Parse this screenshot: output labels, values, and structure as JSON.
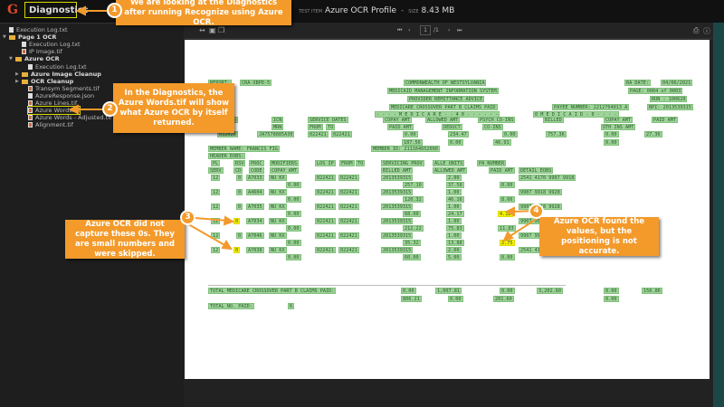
{
  "header": {
    "logo": "G",
    "title": "Diagnostics",
    "test_item_label": "TEST ITEM",
    "test_item": "Azure OCR Profile",
    "separator": "-",
    "size_label": "SIZE",
    "size": "8.43 MB"
  },
  "tree": [
    {
      "label": "Execution Log.txt",
      "icon": "file-icon"
    },
    {
      "label": "Page 1 OCR",
      "icon": "folder-icon"
    },
    {
      "label": "Execution Log.txt",
      "icon": "file-icon"
    },
    {
      "label": "IP Image.tif",
      "icon": "image-icon"
    },
    {
      "label": "Azure OCR",
      "icon": "folder-icon"
    },
    {
      "label": "Execution Log.txt",
      "icon": "file-icon"
    },
    {
      "label": "Azure Image Cleanup",
      "icon": "folder-icon"
    },
    {
      "label": "OCR Cleanup",
      "icon": "folder-icon"
    },
    {
      "label": "Transym Segments.tif",
      "icon": "image-icon"
    },
    {
      "label": "AzureResponse.json",
      "icon": "file-icon"
    },
    {
      "label": "Azure Lines.tif",
      "icon": "image-icon"
    },
    {
      "label": "Azure Words.tif",
      "icon": "image-icon"
    },
    {
      "label": "Azure Words - Adjusted.tif",
      "icon": "image-icon"
    },
    {
      "label": "Alignment.tif",
      "icon": "image-icon"
    }
  ],
  "viewer": {
    "page_current": "1",
    "page_total": "/1"
  },
  "document": {
    "rows": [
      [
        "REPORT:",
        "CRA-XBPD-5",
        "COMMONWEALTH OF WESTSYLVANIA",
        "RA DATE:",
        "04/06/2021"
      ],
      [
        "MEDICAID MANAGEMENT INFORMATION SYSTEM",
        "PAGE: 0004 of 0003"
      ],
      [
        "PROVIDER REMITTANCE ADVICE",
        "RUN : 100620"
      ],
      [
        "MEDICARE CROSSOVER PART B CLAIMS PAID",
        "PAYEE NUMBER: 2212764013 A",
        "NPI: 2013539315"
      ],
      [
        "- - - - M E D I C A R E - - 4 0 - - - - - -",
        "0 M E D I C A I D - 0 - - - -"
      ],
      [
        "N--",
        "ICN",
        "SERVICE DATES",
        "COPAY AMT",
        "ALLOWED AMT",
        "PSYCH CO-INS",
        "BILLED",
        "COPAY AMT",
        "PAID AMT"
      ],
      [
        "MRN",
        "FROM",
        "TO",
        "PAID AMT",
        "DEDUCT",
        "CO-INS",
        "OTH INS AMT"
      ],
      [
        "032026",
        "JA7578885A30",
        "022421",
        "022421",
        "0.00",
        "234.47",
        "0.00",
        "757.36",
        "0.00",
        "27.36"
      ],
      [
        "187.56",
        "0.00",
        "46.91",
        "0.00"
      ],
      [
        "MEMBER NAME: FRANCIS FIG",
        "MEMBER ID: 211164652090"
      ],
      [
        "HEADER EOBS:"
      ],
      [
        "PL",
        "RSV",
        "PROC",
        "MODIFIERS",
        "LOS IP",
        "FROM",
        "TO",
        "SERVICING PROV",
        "ALLE UNITS",
        "PA NUMBER"
      ],
      [
        "SERV",
        "CD",
        "CODE",
        "COPAY AMT",
        "BILLED AMT",
        "ALLOWED AMT",
        "PAID AMT",
        "DETAIL EOBS"
      ],
      [
        "12",
        "0",
        "A7033",
        "NU KX",
        "022421",
        "022421",
        "2013539315",
        "2.00",
        "2541 4170 9907 9918"
      ],
      [
        "0.00",
        "257.10",
        "37.58",
        "0.00"
      ],
      [
        "12",
        "0",
        "A4604",
        "NU KX",
        "022421",
        "022421",
        "2013539315",
        "1.00",
        "9907 9918 9928"
      ],
      [
        "0.00",
        "120.32",
        "46.16",
        "8.66"
      ],
      [
        "12",
        "0",
        "A7035",
        "NU KX",
        "022421",
        "022421",
        "2013539315",
        "1.00",
        "9907 9918 9928"
      ],
      [
        "0.00",
        "68.00",
        "24.17",
        "4.12"
      ],
      [
        "12",
        "0",
        "A7034",
        "NU KX",
        "022421",
        "022421",
        "2013539315",
        "1.00",
        "9907 9918 9928"
      ],
      [
        "0.00",
        "212.22",
        "75.83",
        "11.83"
      ],
      [
        "12",
        "0",
        "A7046",
        "NU KX",
        "022421",
        "022421",
        "2013539315",
        "1.00",
        "9907 9918 9928"
      ],
      [
        "0.00",
        "35.32",
        "13.88",
        "2.75"
      ],
      [
        "12",
        "0",
        "A7038",
        "NU KX",
        "022421",
        "022421",
        "2013539315",
        "2.00",
        "2541 4170 9907 9918"
      ],
      [
        "0.00",
        "60.00",
        "5.00",
        "0.00"
      ],
      [
        "TOTAL MEDICARE CROSSOVER PART B CLAIMS PAID:",
        "0.00",
        "1,007.81",
        "0.00",
        "3,202.60",
        "0.00",
        "150.86"
      ],
      [
        "806.21",
        "0.00",
        "201.60",
        "0.00"
      ],
      [
        "TOTAL NO. PAID:",
        "6"
      ]
    ]
  },
  "callouts": [
    {
      "num": "1",
      "text": "We are looking at the Diagnostics after running Recognize using Azure OCR."
    },
    {
      "num": "2",
      "text": "In the Diagnostics, the Azure Words.tif will show what Azure OCR by itself returned."
    },
    {
      "num": "3",
      "text": "Azure OCR did not capture these 0s. They are small numbers and were skipped."
    },
    {
      "num": "4",
      "text": "Azure OCR found the values, but the positioning is not accurate."
    }
  ],
  "colors": {
    "accent": "#f39a2b",
    "highlight": "#f4f000",
    "ocr_word": "#9fd49a"
  }
}
